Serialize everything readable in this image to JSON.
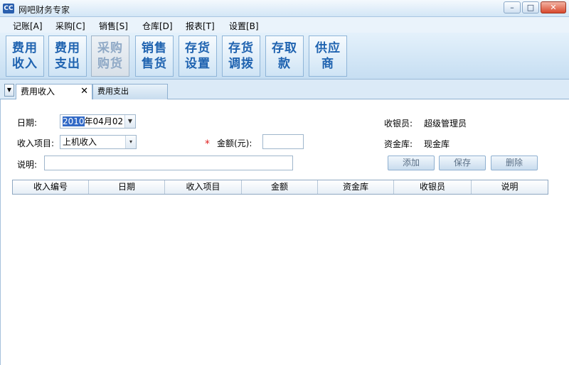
{
  "window": {
    "title": "网吧财务专家",
    "icon": "app-logo-icon"
  },
  "menu": [
    {
      "label": "记账[A]"
    },
    {
      "label": "采购[C]"
    },
    {
      "label": "销售[S]"
    },
    {
      "label": "仓库[D]"
    },
    {
      "label": "报表[T]"
    },
    {
      "label": "设置[B]"
    }
  ],
  "toolbar": [
    {
      "line1": "费用",
      "line2": "收入"
    },
    {
      "line1": "费用",
      "line2": "支出"
    },
    {
      "line1": "采购",
      "line2": "购货"
    },
    {
      "line1": "销售",
      "line2": "售货"
    },
    {
      "line1": "存货",
      "line2": "设置"
    },
    {
      "line1": "存货",
      "line2": "调拨"
    },
    {
      "line1": "存取",
      "line2": "款"
    },
    {
      "line1": "供应",
      "line2": "商"
    }
  ],
  "tabs": {
    "active": "费用收入",
    "inactive": "费用支出"
  },
  "form": {
    "date_label": "日期:",
    "date_year": "2010",
    "date_rest": "年04月02日",
    "income_item_label": "收入项目:",
    "income_item_value": "上机收入",
    "amount_label": "金额(元):",
    "amount_value": "",
    "required_mark": "*",
    "note_label": "说明:",
    "note_value": "",
    "cashier_label": "收银员:",
    "cashier_value": "超级管理员",
    "vault_label": "资金库:",
    "vault_value": "现金库"
  },
  "buttons": {
    "add": "添加",
    "save": "保存",
    "delete": "删除"
  },
  "table": {
    "columns": [
      "收入编号",
      "日期",
      "收入项目",
      "金额",
      "资金库",
      "收银员",
      "说明"
    ]
  }
}
